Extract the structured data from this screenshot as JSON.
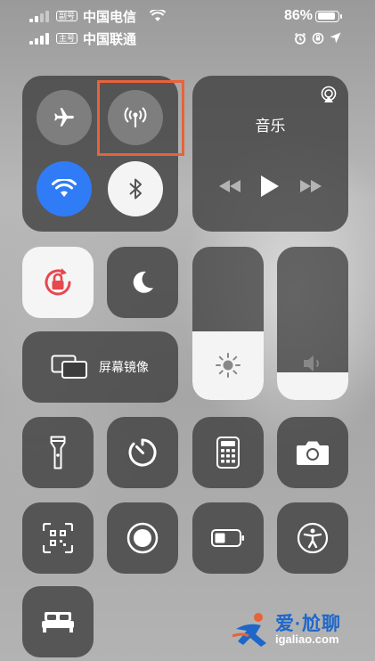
{
  "status_bar": {
    "row1": {
      "sim_tag": "副号",
      "carrier": "中国电信",
      "battery_percent": "86%"
    },
    "row2": {
      "sim_tag": "主号",
      "carrier": "中国联通"
    }
  },
  "connectivity": {
    "airplane_mode": {
      "state": "off"
    },
    "cellular_data": {
      "state": "off",
      "highlighted": true
    },
    "wifi": {
      "state": "on"
    },
    "bluetooth": {
      "state": "on"
    }
  },
  "music": {
    "title": "音乐"
  },
  "tiles": {
    "screen_mirroring": {
      "label": "屏幕镜像"
    },
    "orientation_lock": {
      "state": "on"
    },
    "do_not_disturb": {
      "state": "off"
    }
  },
  "sliders": {
    "brightness_level": 0.45,
    "volume_level": 0.18
  },
  "colors": {
    "accent_blue": "#2f7cf6",
    "highlight_orange": "#e8623a",
    "lock_red": "#e5484d",
    "watermark_blue": "#1e67c9"
  },
  "watermark": {
    "text": "爱·尬聊",
    "url": "igaliao.com"
  }
}
